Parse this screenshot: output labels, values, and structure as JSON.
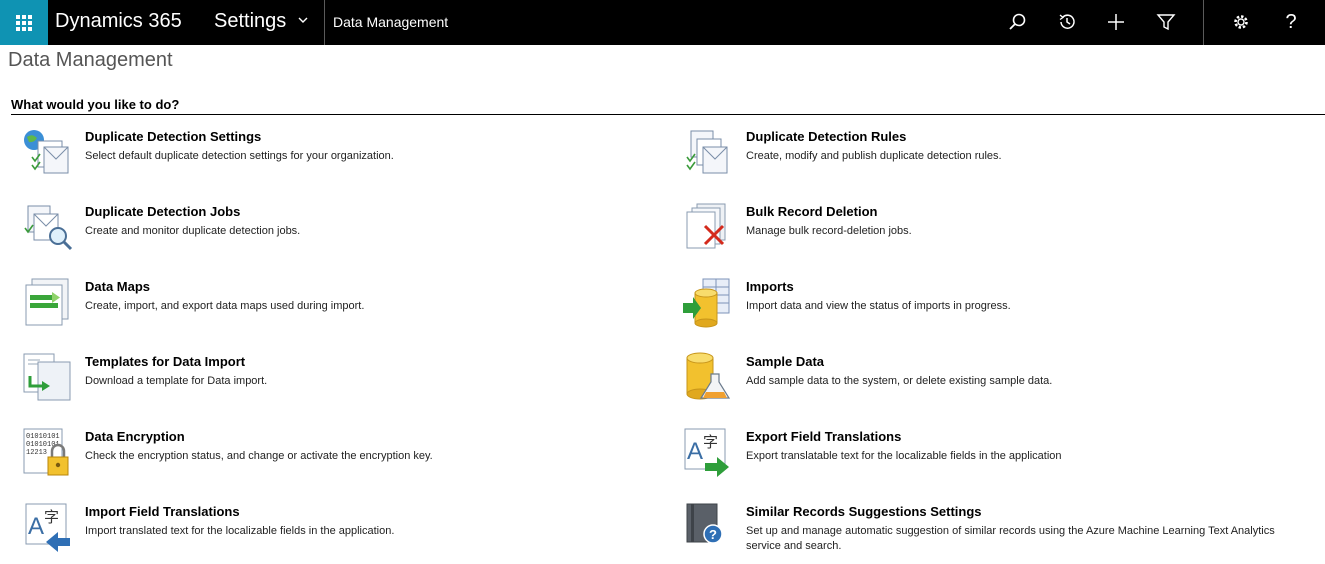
{
  "nav": {
    "app_title": "Dynamics 365",
    "area": "Settings",
    "breadcrumb": "Data Management",
    "icons": [
      "search-icon",
      "recent-icon",
      "add-icon",
      "filter-icon",
      "gear-icon",
      "help-icon"
    ],
    "help_glyph": "?"
  },
  "page": {
    "title": "Data Management",
    "heading": "What would you like to do?"
  },
  "tiles": [
    {
      "title": "Duplicate Detection Settings",
      "desc": "Select default duplicate detection settings for your organization.",
      "icon": "duplicate-detection-settings-icon"
    },
    {
      "title": "Duplicate Detection Rules",
      "desc": "Create, modify and publish duplicate detection rules.",
      "icon": "duplicate-detection-rules-icon"
    },
    {
      "title": "Duplicate Detection Jobs",
      "desc": "Create and monitor duplicate detection jobs.",
      "icon": "duplicate-detection-jobs-icon"
    },
    {
      "title": "Bulk Record Deletion",
      "desc": "Manage bulk record-deletion jobs.",
      "icon": "bulk-record-deletion-icon"
    },
    {
      "title": "Data Maps",
      "desc": "Create, import, and export data maps used during import.",
      "icon": "data-maps-icon"
    },
    {
      "title": "Imports",
      "desc": "Import data and view the status of imports in progress.",
      "icon": "imports-icon"
    },
    {
      "title": "Templates for Data Import",
      "desc": "Download a template for Data import.",
      "icon": "templates-icon"
    },
    {
      "title": "Sample Data",
      "desc": "Add sample data to the system, or delete existing sample data.",
      "icon": "sample-data-icon"
    },
    {
      "title": "Data Encryption",
      "desc": "Check the encryption status, and change or activate the encryption key.",
      "icon": "data-encryption-icon",
      "icon_text": [
        "01010101",
        "01010101",
        "12213"
      ]
    },
    {
      "title": "Export Field Translations",
      "desc": "Export translatable text for the localizable fields in the application",
      "icon": "export-translations-icon",
      "icon_text": [
        "A",
        "字"
      ]
    },
    {
      "title": "Import Field Translations",
      "desc": "Import translated text for the localizable fields in the application.",
      "icon": "import-translations-icon",
      "icon_text": [
        "A",
        "字"
      ]
    },
    {
      "title": "Similar Records Suggestions Settings",
      "desc": "Set up and manage automatic suggestion of similar records using the Azure Machine Learning Text Analytics service and search.",
      "icon": "similar-records-icon",
      "icon_text": [
        "?"
      ]
    }
  ],
  "colors": {
    "topbar": "#000000",
    "waffle": "#0f93b3",
    "page_title": "#555555"
  }
}
